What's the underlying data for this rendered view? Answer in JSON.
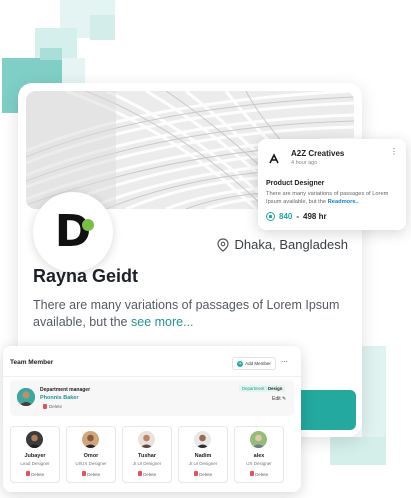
{
  "profile": {
    "location": "Dhaka, Bangladesh",
    "name": "Rayna Geidt",
    "bio": "There are many variations of passages of Lorem Ipsum available, but the",
    "see_more": "see more...",
    "logo_letter": "D"
  },
  "job": {
    "company": "A2Z Creatives",
    "logo_text": "A",
    "time": "4 hour ago",
    "title": "Product Designer",
    "description": "There are many variations of passages of Lorem Ipsum available, but the",
    "read_more": "Readmore..",
    "points": "840",
    "hours": "498 hr",
    "separator": "-"
  },
  "team": {
    "title": "Team Member",
    "add_label": "Add Member",
    "manager": {
      "role": "Department manager",
      "name": "Phonnis Baker",
      "dept_prefix": "Department :",
      "dept": "Design",
      "edit": "Edit",
      "delete": "Delete"
    },
    "members": [
      {
        "name": "Jubayer",
        "role": "Lead Designer",
        "delete": "Delete"
      },
      {
        "name": "Omor",
        "role": "UI/UX Designer",
        "delete": "Delete"
      },
      {
        "name": "Tushar",
        "role": "Jr.UI Designer",
        "delete": "Delete"
      },
      {
        "name": "Nadim",
        "role": "Jr.UI Designer",
        "delete": "Delete"
      },
      {
        "name": "alex",
        "role": "UX Designer",
        "delete": "Delete"
      }
    ]
  },
  "colors": {
    "accent": "#23a99e",
    "accent_dark": "#23958d",
    "logo_dot": "#7ac142",
    "deco_teal": "#7fcfc7"
  },
  "icons": {
    "location": "map-pin-icon",
    "points": "hand-point-icon",
    "more": "more-dots-icon",
    "add": "plus-circle-icon",
    "edit": "pencil-icon",
    "delete": "trash-icon"
  }
}
